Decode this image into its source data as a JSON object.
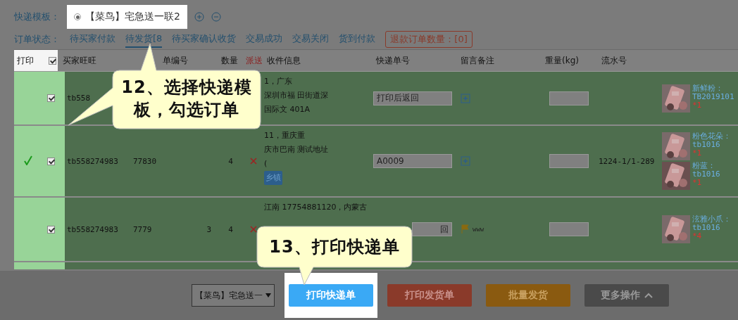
{
  "template": {
    "label": "快递模板：",
    "options": [
      {
        "text": "【菜鸟】宅急送一联2",
        "selected": true
      }
    ]
  },
  "status": {
    "label": "订单状态：",
    "tabs": [
      {
        "text": "待买家付款",
        "selected": false
      },
      {
        "text": "待发货[8",
        "selected": true
      },
      {
        "text": "待买家确认收货",
        "selected": false
      },
      {
        "text": "交易成功",
        "selected": false
      },
      {
        "text": "交易关闭",
        "selected": false
      },
      {
        "text": "货到付款",
        "selected": false
      }
    ],
    "refund": "退款订单数量：[0]"
  },
  "table": {
    "columns": [
      "打印",
      "",
      "买家旺旺",
      "单编号",
      "数量",
      "派送",
      "收件信息",
      "快递单号",
      "留言备注",
      "重量(kg)",
      "流水号"
    ],
    "all_checked": true,
    "rows": [
      {
        "printed": false,
        "checked": true,
        "buyer": "tb558",
        "order": "",
        "column_5": "",
        "qty": "",
        "dispatch_failed": false,
        "address": [
          "1，广东",
          "深圳市福 田街道深",
          "国际文 401A"
        ],
        "tag": "",
        "express": "打印后返回",
        "note_add": true,
        "flagged": false,
        "note": "",
        "serial": "",
        "products": [
          {
            "name": "新鲜粉：",
            "code": "TB2019101",
            "count": "*1"
          }
        ]
      },
      {
        "printed": true,
        "checked": true,
        "buyer": "tb558274983",
        "order": "77830",
        "column_5": "",
        "qty": "4",
        "dispatch_failed": true,
        "address": [
          "11，重庆重",
          "庆市巴南 测试地址",
          "("
        ],
        "tag": "乡镇",
        "express": "A0009",
        "note_add": true,
        "flagged": false,
        "note": "",
        "serial": "1224-1/1-289",
        "products": [
          {
            "name": "粉色花朵：",
            "code": "tb1016",
            "count": "*1"
          },
          {
            "name": "粉蓝：",
            "code": "tb1016",
            "count": "*1"
          }
        ]
      },
      {
        "printed": false,
        "checked": true,
        "buyer": "tb558274983",
        "order": "7779",
        "column_5": "3",
        "qty": "4",
        "dispatch_failed": true,
        "address": [
          "江南 17754881120，内蒙古"
        ],
        "tag": "",
        "express": "回",
        "note_add": false,
        "flagged": true,
        "note": "www",
        "serial": "",
        "products": [
          {
            "name": "泫雅小爪：",
            "code": "tb1016",
            "count": "*4"
          }
        ]
      }
    ]
  },
  "bottom": {
    "select": "【菜鸟】宅急送一",
    "buttons": [
      {
        "text": "打印快递单",
        "kind": "primary"
      },
      {
        "text": "打印发货单",
        "kind": "danger"
      },
      {
        "text": "批量发货",
        "kind": "warning"
      },
      {
        "text": "更多操作",
        "kind": "more"
      }
    ]
  },
  "callouts": [
    {
      "text": "12、选择快递模板，勾选订单"
    },
    {
      "text": "13、打印快递单"
    }
  ]
}
